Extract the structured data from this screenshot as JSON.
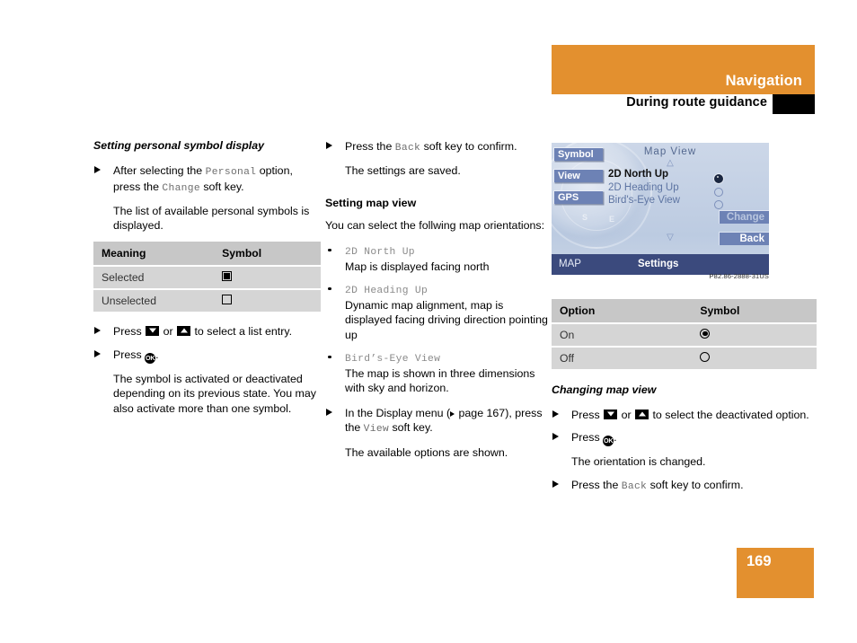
{
  "header": {
    "title": "Navigation",
    "subtitle": "During route guidance"
  },
  "colors": {
    "accent": "#e3902f",
    "screen_tab": "#6d82b5",
    "screen_footer": "#3b4a7d",
    "table_header": "#c7c7c7",
    "table_row": "#d5d5d5"
  },
  "column_left": {
    "section_title": "Setting personal symbol display",
    "step1_pre": "After selecting the ",
    "step1_mono1": "Personal",
    "step1_mid": " option, press the ",
    "step1_mono2": "Change",
    "step1_post": " soft key.",
    "note1": "The list of available personal symbols is displayed.",
    "table": {
      "headers": [
        "Meaning",
        "Symbol"
      ],
      "rows": [
        {
          "meaning": "Selected",
          "symbol": "filled-square"
        },
        {
          "meaning": "Unselected",
          "symbol": "empty-square"
        }
      ]
    },
    "step2_pre": "Press ",
    "step2_or": " or ",
    "step2_post": " to select a list entry.",
    "step3_pre": "Press ",
    "step3_post": ".",
    "note2": "The symbol is activated or deactivated depending on its previous state. You may also activate more than one symbol."
  },
  "column_middle": {
    "step1_pre": "Press the ",
    "step1_mono": "Back",
    "step1_post": " soft key to confirm.",
    "note1": "The settings are saved.",
    "section_title": "Setting map view",
    "intro": "You can select the follwing map orientations:",
    "bullets": [
      {
        "mono": "2D North Up",
        "desc": "Map is displayed facing north"
      },
      {
        "mono": "2D Heading Up",
        "desc": "Dynamic map alignment, map is displayed facing driving direction pointing up"
      },
      {
        "mono": "Bird’s-Eye View",
        "desc": "The map is shown in three dimensions with sky and horizon."
      }
    ],
    "step2_pre": "In the Display menu (",
    "step2_page": " page 167), press the ",
    "step2_mono": "View",
    "step2_post": " soft key.",
    "note2": "The available options are shown."
  },
  "screen": {
    "tabs": [
      "Symbol",
      "View",
      "GPS"
    ],
    "title": "Map View",
    "scroll_up": "△",
    "scroll_down": "▽",
    "options": [
      {
        "label": "2D North Up",
        "selected": true
      },
      {
        "label": "2D Heading Up",
        "selected": false
      },
      {
        "label": "Bird's-Eye View",
        "selected": false
      }
    ],
    "softkeys": [
      {
        "label": "Change",
        "enabled": false
      },
      {
        "label": "Back",
        "enabled": true
      }
    ],
    "footer_left": "MAP",
    "footer_center": "Settings",
    "caption": "P82.86-2888-31US"
  },
  "column_right": {
    "table": {
      "headers": [
        "Option",
        "Symbol"
      ],
      "rows": [
        {
          "option": "On",
          "symbol": "filled-radio"
        },
        {
          "option": "Off",
          "symbol": "empty-radio"
        }
      ]
    },
    "section_title": "Changing map view",
    "step1_pre": "Press ",
    "step1_or": " or ",
    "step1_post": " to select the deactivated option.",
    "step2_pre": "Press ",
    "step2_post": ".",
    "note1": "The orientation is changed.",
    "step3_pre": "Press the ",
    "step3_mono": "Back",
    "step3_post": " soft key to confirm."
  },
  "footer": {
    "page_number": "169"
  }
}
